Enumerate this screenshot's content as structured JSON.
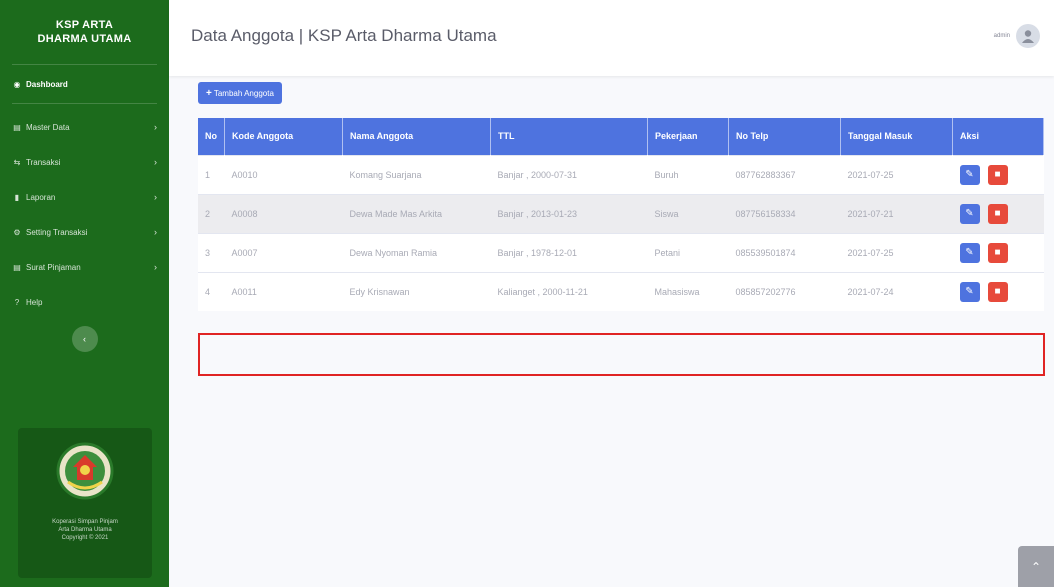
{
  "sidebar": {
    "brand_line1": "KSP ARTA",
    "brand_line2": "DHARMA UTAMA",
    "dashboard": "Dashboard",
    "items": [
      {
        "label": "Master Data"
      },
      {
        "label": "Transaksi"
      },
      {
        "label": "Laporan"
      },
      {
        "label": "Setting Transaksi"
      },
      {
        "label": "Surat Pinjaman"
      }
    ],
    "help": "Help",
    "footer_line1": "Koperasi Simpan Pinjam",
    "footer_line2": "Arta Dharma Utama",
    "footer_line3": "Copyright © 2021"
  },
  "topbar": {
    "title": "Data Anggota | KSP Arta Dharma Utama",
    "user_name": "admin"
  },
  "content": {
    "add_button": "Tambah Anggota",
    "headers": [
      "No",
      "Kode Anggota",
      "Nama Anggota",
      "TTL",
      "Pekerjaan",
      "No Telp",
      "Tanggal Masuk",
      "Aksi"
    ],
    "rows": [
      {
        "no": "1",
        "kode": "A0010",
        "nama": "Komang Suarjana",
        "ttl": "Banjar , 2000-07-31",
        "pekerjaan": "Buruh",
        "telp": "087762883367",
        "tanggal": "2021-07-25"
      },
      {
        "no": "2",
        "kode": "A0008",
        "nama": "Dewa Made Mas Arkita",
        "ttl": "Banjar , 2013-01-23",
        "pekerjaan": "Siswa",
        "telp": "087756158334",
        "tanggal": "2021-07-21"
      },
      {
        "no": "3",
        "kode": "A0007",
        "nama": "Dewa Nyoman Ramia",
        "ttl": "Banjar , 1978-12-01",
        "pekerjaan": "Petani",
        "telp": "085539501874",
        "tanggal": "2021-07-25"
      },
      {
        "no": "4",
        "kode": "A0011",
        "nama": "Edy Krisnawan",
        "ttl": "Kalianget , 2000-11-21",
        "pekerjaan": "Mahasiswa",
        "telp": "085857202776",
        "tanggal": "2021-07-24"
      }
    ]
  },
  "colors": {
    "sidebar": "#1c6b1c",
    "primary": "#4e73df",
    "danger": "#e74a3b",
    "highlight": "#e02424"
  }
}
